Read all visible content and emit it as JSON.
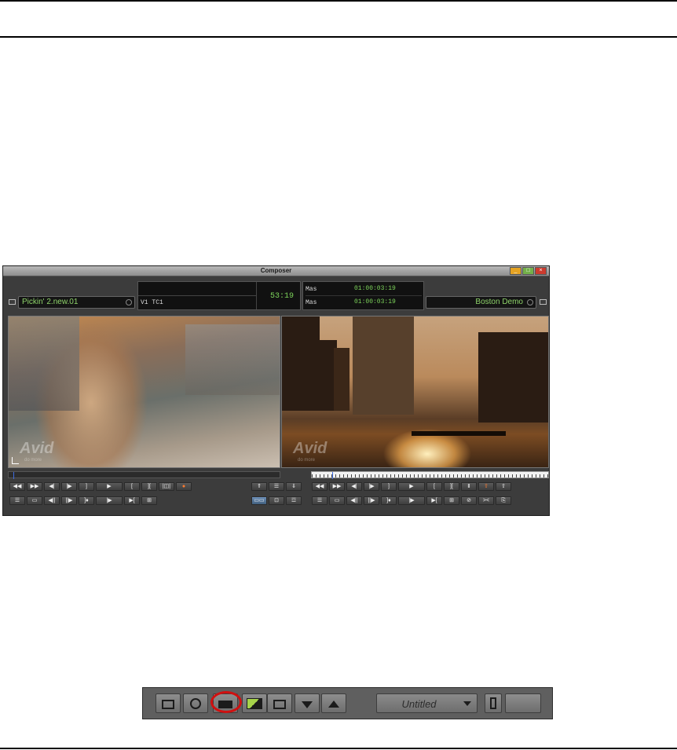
{
  "composer": {
    "title": "Composer",
    "window_buttons": {
      "minimize": "_",
      "maximize": "□",
      "close": "×"
    },
    "source_clip": "Pickin' 2.new.01",
    "record_sequence": "Boston Demo",
    "center_panel": {
      "track_label": "V1 TC1",
      "timecode": "53:19"
    },
    "record_tc_rows": [
      {
        "label": "Mas",
        "value": "01:00:03:19"
      },
      {
        "label": "Mas",
        "value": "01:00:03:19"
      }
    ],
    "watermark_text": "Avid",
    "watermark_sub": "do more",
    "source_buttons_row1": [
      "◀◀",
      "▶▶",
      "◀|",
      "|▶",
      "]",
      "▶",
      "[",
      "][",
      "|◫|",
      "●"
    ],
    "source_buttons_row2": [
      "☰",
      "▭",
      "◀||",
      "||▶",
      "]♦",
      "|▶",
      "▶[",
      "⊞"
    ],
    "center_buttons_row1": [
      "⇑",
      "☰",
      "⇓"
    ],
    "center_buttons_row2": [
      "▭▭",
      "⊡",
      "☲"
    ],
    "record_buttons_row1": [
      "◀◀",
      "▶▶",
      "◀|",
      "|▶",
      "]",
      "▶",
      "[",
      "][",
      "Ⅱ",
      "⇧",
      "⇧"
    ],
    "record_buttons_row2": [
      "☰",
      "▭",
      "◀||",
      "||▶",
      "]♦",
      "|▶",
      "▶[",
      "⊞",
      "⊘",
      "><",
      "⎘"
    ]
  },
  "toolbar": {
    "project_name": "Untitled",
    "highlighted_button": "source-record-mode-button"
  },
  "colors": {
    "timecode_green": "#7cd35a",
    "highlight_circle": "#d01010"
  }
}
